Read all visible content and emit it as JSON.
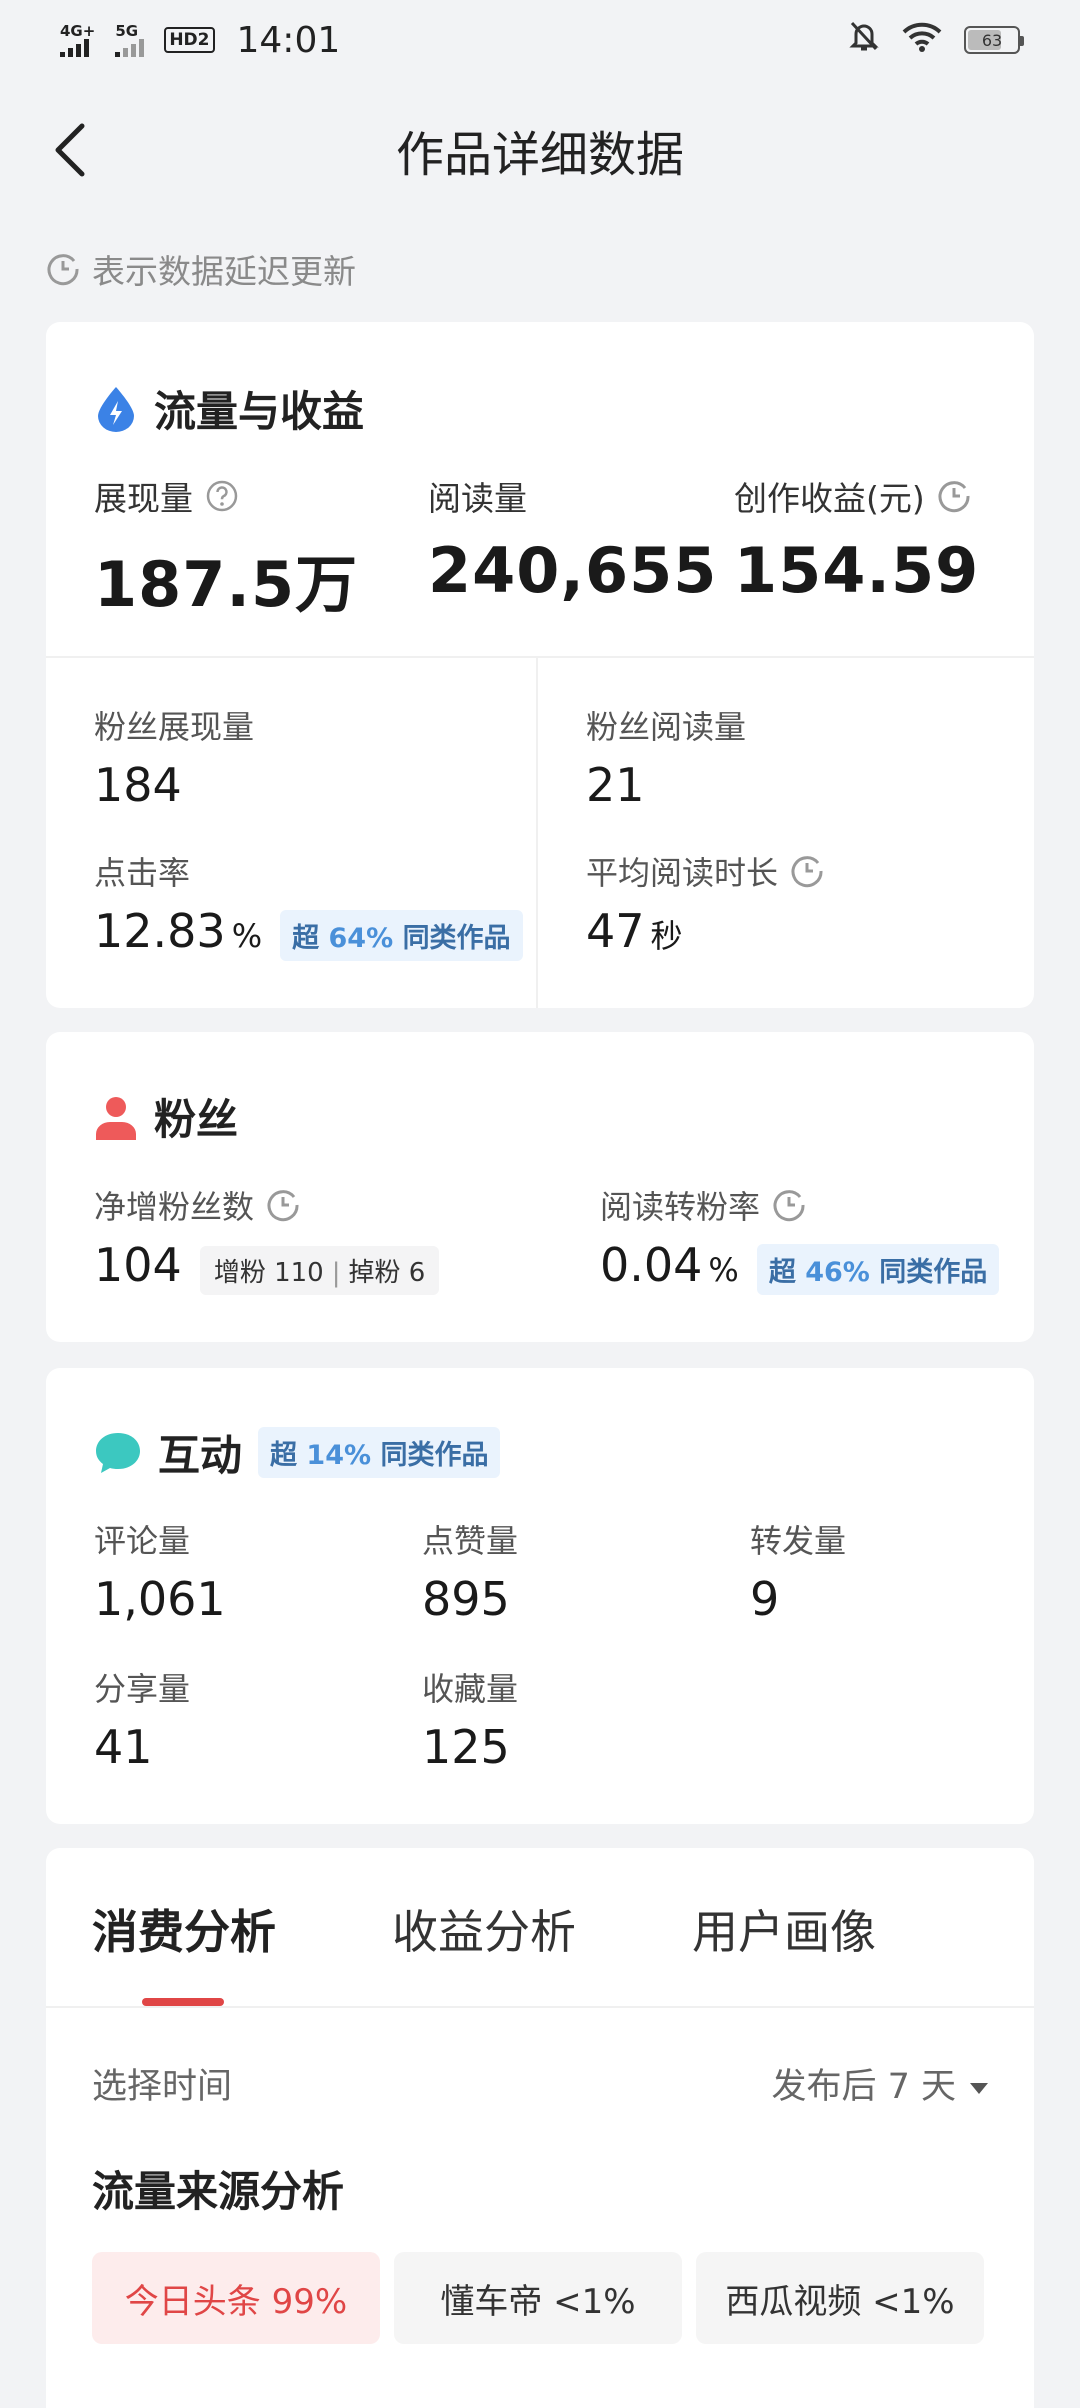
{
  "status_bar": {
    "net1": "4G+",
    "net2": "5G",
    "hd": "HD2",
    "time": "14:01",
    "battery": "63"
  },
  "nav": {
    "title": "作品详细数据"
  },
  "delay_note": "表示数据延迟更新",
  "traffic": {
    "title": "流量与收益",
    "impressions_label": "展现量",
    "impressions_value": "187.5万",
    "reads_label": "阅读量",
    "reads_value": "240,655",
    "income_label": "创作收益(元)",
    "income_value": "154.59",
    "fan_impressions_label": "粉丝展现量",
    "fan_impressions_value": "184",
    "fan_reads_label": "粉丝阅读量",
    "fan_reads_value": "21",
    "ctr_label": "点击率",
    "ctr_value": "12.83",
    "ctr_unit": "%",
    "ctr_badge_pre": "超",
    "ctr_badge_num": "64%",
    "ctr_badge_post": "同类作品",
    "avg_time_label": "平均阅读时长",
    "avg_time_value": "47",
    "avg_time_unit": "秒"
  },
  "fans": {
    "title": "粉丝",
    "net_label": "净增粉丝数",
    "net_value": "104",
    "gain_label": "增粉",
    "gain_value": "110",
    "lose_label": "掉粉",
    "lose_value": "6",
    "conv_label": "阅读转粉率",
    "conv_value": "0.04",
    "conv_unit": "%",
    "conv_badge_pre": "超",
    "conv_badge_num": "46%",
    "conv_badge_post": "同类作品"
  },
  "interaction": {
    "title": "互动",
    "badge_pre": "超",
    "badge_num": "14%",
    "badge_post": "同类作品",
    "comments_label": "评论量",
    "comments_value": "1,061",
    "likes_label": "点赞量",
    "likes_value": "895",
    "reposts_label": "转发量",
    "reposts_value": "9",
    "shares_label": "分享量",
    "shares_value": "41",
    "favs_label": "收藏量",
    "favs_value": "125"
  },
  "analysis": {
    "tabs": [
      "消费分析",
      "收益分析",
      "用户画像"
    ],
    "time_label": "选择时间",
    "time_value": "发布后 7 天",
    "flow_title": "流量来源分析",
    "sources": [
      {
        "label": "今日头条 99%"
      },
      {
        "label": "懂车帝 <1%"
      },
      {
        "label": "西瓜视频 <1%"
      }
    ]
  },
  "colors": {
    "accent_red": "#e04646",
    "badge_blue": "#4a90d9",
    "card_bg": "#ffffff",
    "page_bg": "#f2f3f5"
  }
}
